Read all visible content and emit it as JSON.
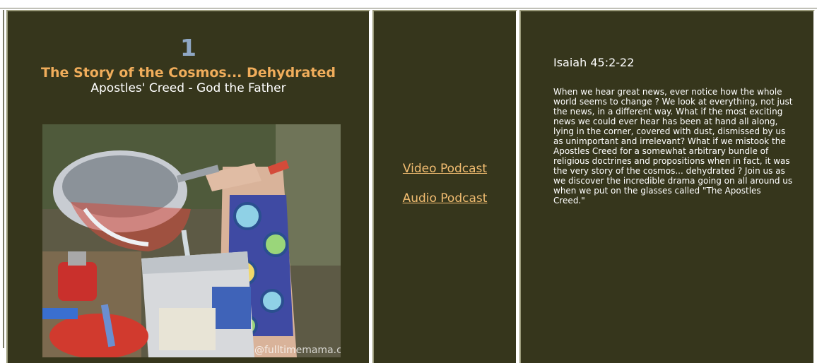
{
  "lesson": {
    "number": "1",
    "title": "The Story of the Cosmos... Dehydrated",
    "subtitle": "Apostles' Creed - God the Father",
    "image_watermark": "@fulltimemama.com"
  },
  "links": {
    "video_label": "Video Podcast",
    "audio_label": "Audio Podcast"
  },
  "description": {
    "passage": "Isaiah 45:2-22",
    "text": "When we hear great news, ever notice how the whole world seems to change ? We look at everything, not just the news, in a different way. What if the most exciting news we could ever hear has been at hand all along, lying in the corner, covered with dust, dismissed by us as unimportant and irrelevant? What if we mistook the Apostles Creed for a somewhat arbitrary bundle of religious doctrines and propositions when in fact, it was the very story of the cosmos... dehydrated ? Join us as we discover the incredible drama going on all around us when we put on the glasses called \"The Apostles Creed.\""
  },
  "colors": {
    "background": "#36361c",
    "number": "#8fa7c4",
    "title": "#f0ad5b",
    "link": "#f2bd71",
    "text": "#ffffff"
  }
}
